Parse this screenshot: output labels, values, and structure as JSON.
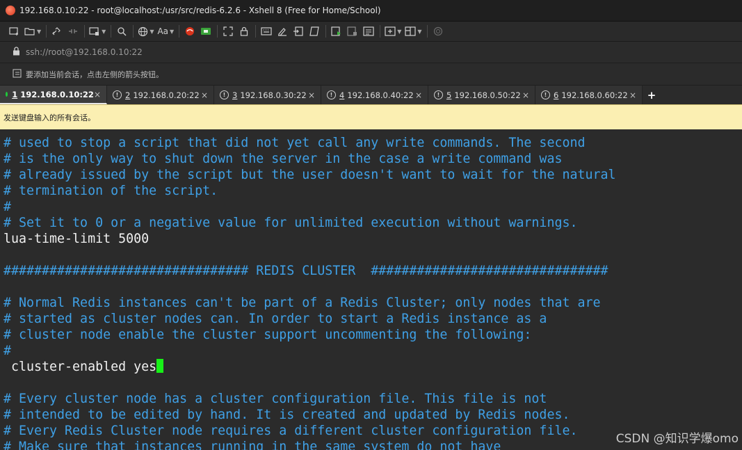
{
  "window": {
    "title": "192.168.0.10:22 - root@localhost:/usr/src/redis-6.2.6 - Xshell 8 (Free for Home/School)"
  },
  "toolbar": {
    "font_label": "Aa",
    "icons": [
      "new-session-icon",
      "open-folder-icon",
      "connect-icon",
      "disconnect-icon",
      "new-window-icon",
      "find-icon",
      "globe-icon",
      "font-icon",
      "xshell-logo-icon",
      "xftp-icon",
      "fullscreen-icon",
      "lock-icon",
      "keyboard-icon",
      "highlight-icon",
      "send-icon",
      "script-icon",
      "start-log-icon",
      "stop-log-icon",
      "properties-icon",
      "add-pane-icon",
      "layout-icon",
      "help-icon"
    ]
  },
  "address": {
    "url": "ssh://root@192.168.0.10:22"
  },
  "hint": {
    "text": "要添加当前会话，点击左侧的箭头按钮。"
  },
  "tabs": [
    {
      "num": "1",
      "label": "192.168.0.10:22",
      "active": true
    },
    {
      "num": "2",
      "label": "192.168.0.20:22",
      "active": false
    },
    {
      "num": "3",
      "label": "192.168.0.30:22",
      "active": false
    },
    {
      "num": "4",
      "label": "192.168.0.40:22",
      "active": false
    },
    {
      "num": "5",
      "label": "192.168.0.50:22",
      "active": false
    },
    {
      "num": "6",
      "label": "192.168.0.60:22",
      "active": false
    }
  ],
  "new_tab_label": "+",
  "tab_close_label": "×",
  "notice": {
    "text": "发送键盘输入的所有会话。"
  },
  "terminal": {
    "lines": [
      {
        "type": "comment",
        "text": "# used to stop a script that did not yet call any write commands. The second"
      },
      {
        "type": "comment",
        "text": "# is the only way to shut down the server in the case a write command was"
      },
      {
        "type": "comment",
        "text": "# already issued by the script but the user doesn't want to wait for the natural"
      },
      {
        "type": "comment",
        "text": "# termination of the script."
      },
      {
        "type": "comment",
        "text": "#"
      },
      {
        "type": "comment",
        "text": "# Set it to 0 or a negative value for unlimited execution without warnings."
      },
      {
        "type": "plain",
        "text": "lua-time-limit 5000"
      },
      {
        "type": "blank",
        "text": ""
      },
      {
        "type": "comment",
        "text": "################################ REDIS CLUSTER  ###############################"
      },
      {
        "type": "blank",
        "text": ""
      },
      {
        "type": "comment",
        "text": "# Normal Redis instances can't be part of a Redis Cluster; only nodes that are"
      },
      {
        "type": "comment",
        "text": "# started as cluster nodes can. In order to start a Redis instance as a"
      },
      {
        "type": "comment",
        "text": "# cluster node enable the cluster support uncommenting the following:"
      },
      {
        "type": "comment",
        "text": "#"
      },
      {
        "type": "cursor",
        "text": " cluster-enabled yes"
      },
      {
        "type": "blank",
        "text": ""
      },
      {
        "type": "comment",
        "text": "# Every cluster node has a cluster configuration file. This file is not"
      },
      {
        "type": "comment",
        "text": "# intended to be edited by hand. It is created and updated by Redis nodes."
      },
      {
        "type": "comment",
        "text": "# Every Redis Cluster node requires a different cluster configuration file."
      },
      {
        "type": "comment",
        "text": "# Make sure that instances running in the same system do not have"
      }
    ]
  },
  "watermark": "CSDN @知识学爆omo",
  "colors": {
    "comment": "#3fa0e6",
    "plain": "#f0f0f0",
    "cursor": "#17f017",
    "notice_bg": "#fbefb2",
    "connected": "#1ecb3a"
  }
}
